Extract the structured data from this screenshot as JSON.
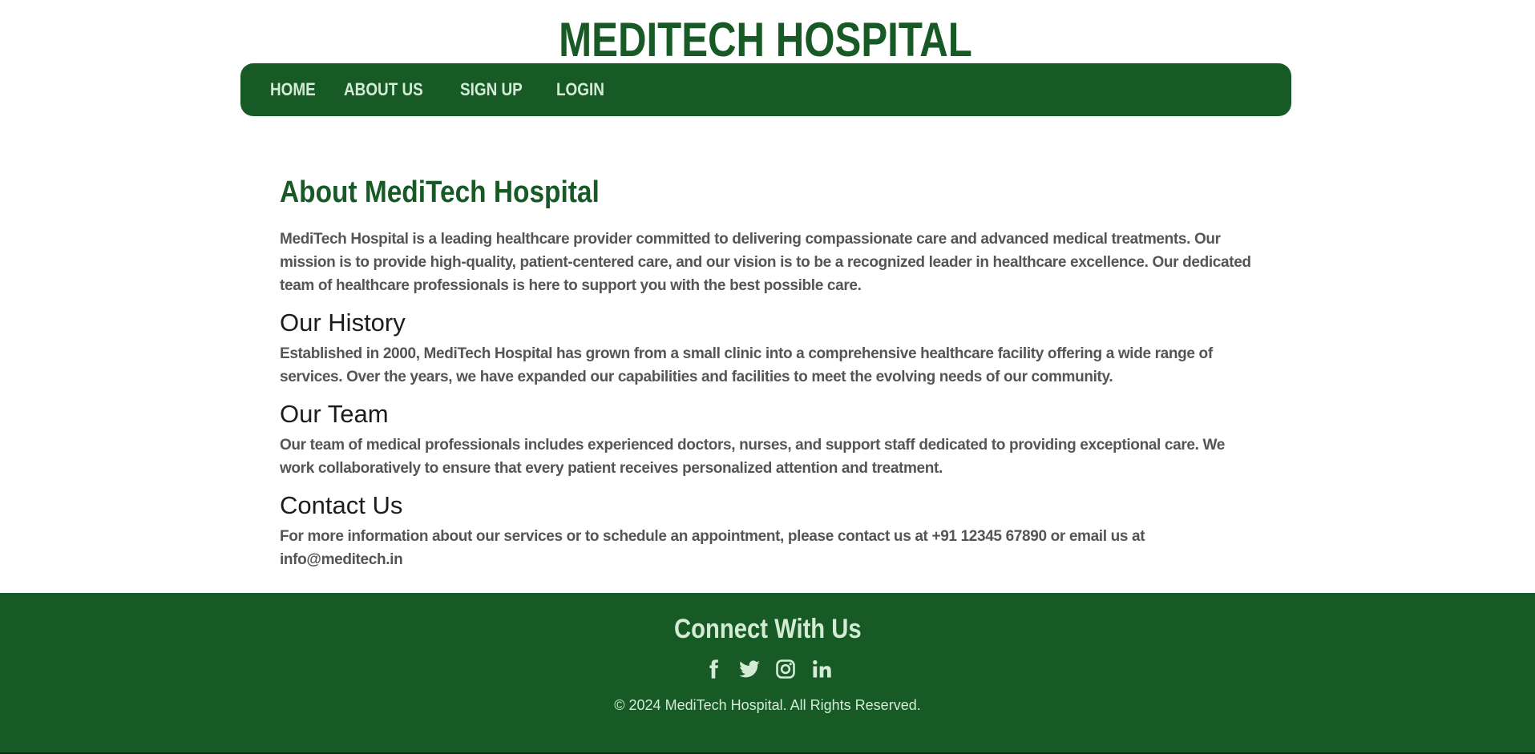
{
  "header": {
    "title": "MEDITECH HOSPITAL"
  },
  "nav": {
    "items": [
      {
        "label": "HOME"
      },
      {
        "label": "ABOUT US"
      },
      {
        "label": "SIGN UP"
      },
      {
        "label": "LOGIN"
      }
    ]
  },
  "main": {
    "title": "About MediTech Hospital",
    "intro": "MediTech Hospital is a leading healthcare provider committed to delivering compassionate care and advanced medical treatments. Our mission is to provide high-quality, patient-centered care, and our vision is to be a recognized leader in healthcare excellence. Our dedicated team of healthcare professionals is here to support you with the best possible care.",
    "sections": [
      {
        "heading": "Our History",
        "text": "Established in 2000, MediTech Hospital has grown from a small clinic into a comprehensive healthcare facility offering a wide range of services. Over the years, we have expanded our capabilities and facilities to meet the evolving needs of our community."
      },
      {
        "heading": "Our Team",
        "text": "Our team of medical professionals includes experienced doctors, nurses, and support staff dedicated to providing exceptional care. We work collaboratively to ensure that every patient receives personalized attention and treatment."
      },
      {
        "heading": "Contact Us",
        "text": "For more information about our services or to schedule an appointment, please contact us at +91 12345 67890 or email us at info@meditech.in"
      }
    ]
  },
  "footer": {
    "title": "Connect With Us",
    "social": [
      "facebook-icon",
      "twitter-icon",
      "instagram-icon",
      "linkedin-icon"
    ],
    "copyright": "© 2024 MediTech Hospital. All Rights Reserved."
  },
  "colors": {
    "brand_green": "#175a26",
    "nav_text": "#d4ecd6",
    "body_text": "#555555"
  }
}
